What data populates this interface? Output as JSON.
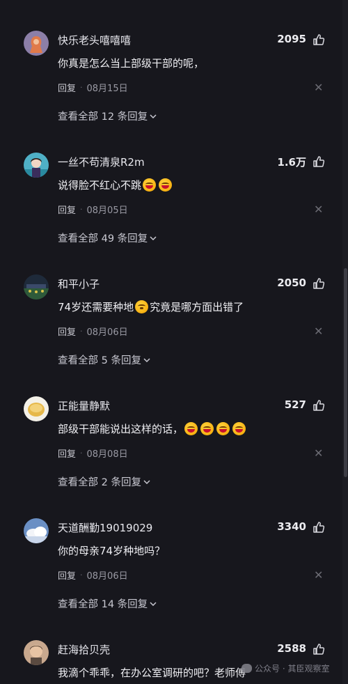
{
  "comments": [
    {
      "username": "快乐老头嘻嘻嘻",
      "likes": "2095",
      "text": "你真是怎么当上部级干部的呢，",
      "reply_label": "回复",
      "date": "08月15日",
      "view_replies": "查看全部 12 条回复"
    },
    {
      "username": "一丝不苟清泉R2m",
      "likes": "1.6万",
      "text": "说得脸不红心不跳",
      "reply_label": "回复",
      "date": "08月05日",
      "view_replies": "查看全部 49 条回复"
    },
    {
      "username": "和平小子",
      "likes": "2050",
      "text_before": "74岁还需要种地",
      "text_after": "究竟是哪方面出错了",
      "reply_label": "回复",
      "date": "08月06日",
      "view_replies": "查看全部 5 条回复"
    },
    {
      "username": "正能量静默",
      "likes": "527",
      "text": "部级干部能说出这样的话，",
      "reply_label": "回复",
      "date": "08月08日",
      "view_replies": "查看全部 2 条回复"
    },
    {
      "username": "天道酬勤19019029",
      "likes": "3340",
      "text": "你的母亲74岁种地吗？",
      "reply_label": "回复",
      "date": "08月06日",
      "view_replies": "查看全部 14 条回复"
    },
    {
      "username": "赶海拾贝壳",
      "likes": "2588",
      "text": "我滴个乖乖，在办公室调研的吧？老师傅"
    }
  ],
  "watermark": "公众号 · 其臣观察室",
  "icons": {
    "like": "thumbs-up-icon",
    "close": "close-icon",
    "expand": "chevron-down-icon",
    "emoji_laugh": "laughing-emoji-icon",
    "emoji_shock": "surprised-emoji-icon"
  },
  "colors": {
    "background": "#17171d",
    "text_primary": "#e8e8ee",
    "text_secondary": "#9a9aa4"
  }
}
